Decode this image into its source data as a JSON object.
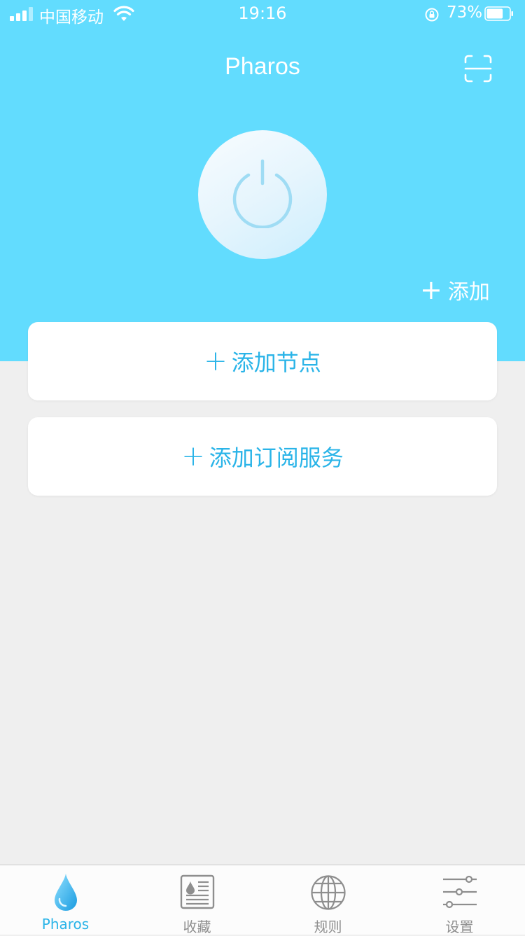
{
  "status_bar": {
    "carrier": "中国移动",
    "time": "19:16",
    "battery": "73%",
    "battery_level": 0.73
  },
  "header": {
    "title": "Pharos",
    "add_label": "添加",
    "add_plus": "+"
  },
  "cards": {
    "add_node": {
      "plus": "+",
      "label": "添加节点"
    },
    "add_subscription": {
      "plus": "+",
      "label": "添加订阅服务"
    }
  },
  "tabbar": {
    "tabs": [
      {
        "label": "Pharos",
        "icon": "droplet-icon",
        "active": true
      },
      {
        "label": "收藏",
        "icon": "favorites-icon",
        "active": false
      },
      {
        "label": "规则",
        "icon": "globe-icon",
        "active": false
      },
      {
        "label": "设置",
        "icon": "sliders-icon",
        "active": false
      }
    ]
  },
  "colors": {
    "header_bg": "#62dcfe",
    "accent": "#2ab4e8",
    "page_bg": "#efefef"
  }
}
